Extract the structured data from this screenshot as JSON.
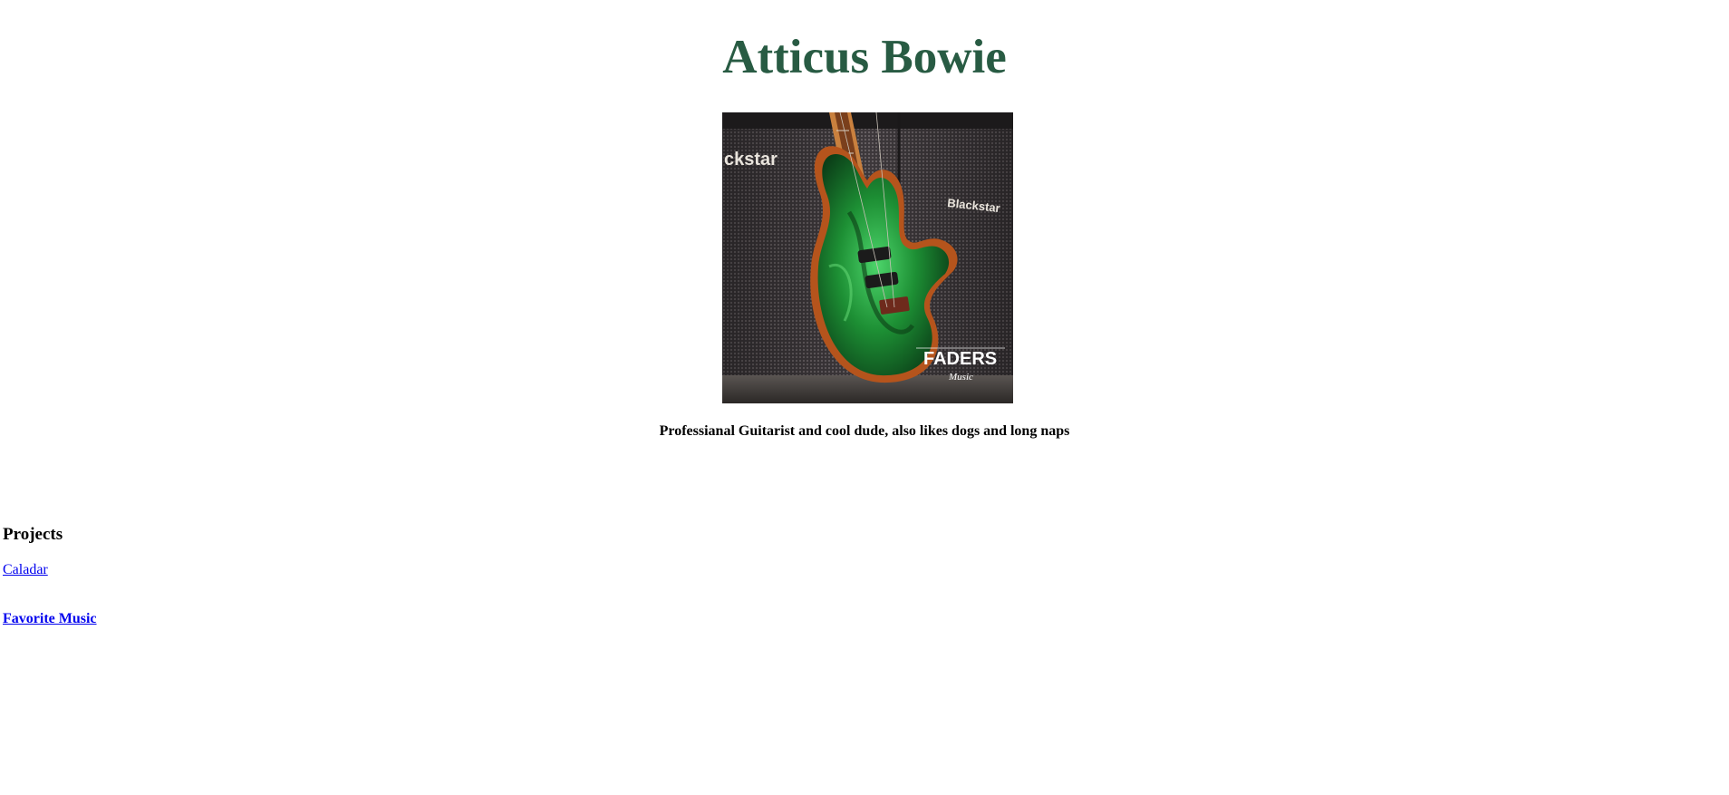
{
  "header": {
    "title": "Atticus Bowie",
    "title_color": "#285b43"
  },
  "profile_photo": {
    "alt": "Green electric guitar leaning against Blackstar amplifiers",
    "amp_brand_left": "ckstar",
    "amp_brand_right": "Blackstar",
    "logo_text": "FADERS",
    "logo_subtext": "Music"
  },
  "bio": {
    "tagline": "Professianal Guitarist and cool dude, also likes dogs and long naps"
  },
  "projects": {
    "heading": "Projects",
    "items": [
      {
        "label": "Caladar"
      }
    ]
  },
  "favorite_music": {
    "label": "Favorite Music"
  },
  "colors": {
    "link": "#0000ee",
    "guitar_green": "#1f9a3a",
    "amp_grille": "#4a4548"
  }
}
